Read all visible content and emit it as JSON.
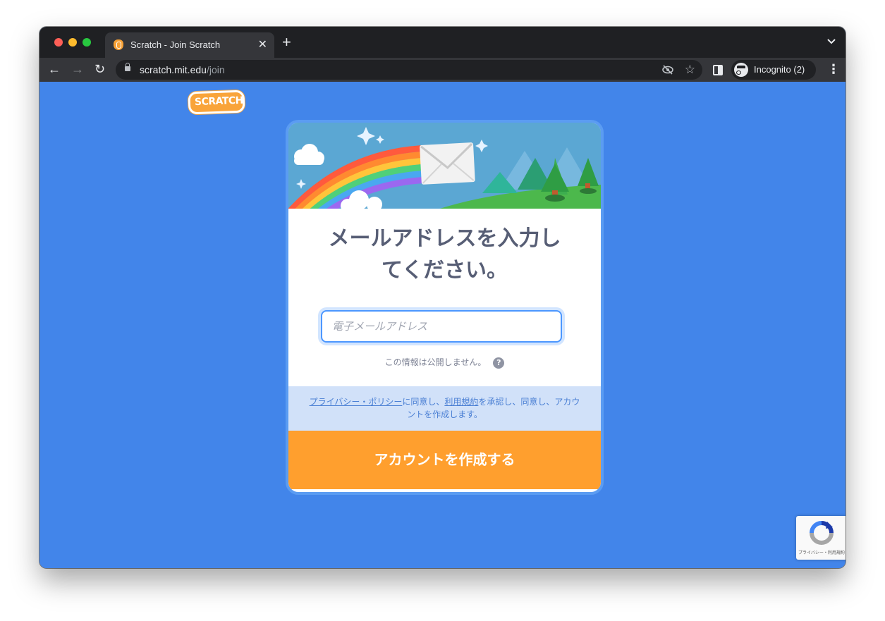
{
  "browser": {
    "tab_title": "Scratch - Join Scratch",
    "tab_close": "✕",
    "new_tab": "+",
    "tab_list": "⌄",
    "back": "←",
    "forward": "→",
    "reload": "↻",
    "url_host": "scratch.mit.edu",
    "url_path": "/join",
    "incognito_label": "Incognito (2)",
    "menu": "⋮",
    "star": "☆",
    "eye": "◉"
  },
  "page": {
    "logo_text": "SCRATCH",
    "heading_line1": "メールアドレスを入力し",
    "heading_line2": "てください。",
    "email_placeholder": "電子メールアドレス",
    "privacy_notice": "この情報は公開しません。",
    "help": "?",
    "consent": {
      "privacy_link": "プライバシー・ポリシー",
      "text1": "に同意し、",
      "terms_link": "利用規約",
      "text2": "を承認し、同意し、アカウントを作成します。"
    },
    "create_button": "アカウントを作成する",
    "recaptcha_text": "プライバシー・利用規約"
  },
  "colors": {
    "page_background": "#4285ea",
    "button": "#ff9f2e",
    "consent_background": "#d1e1f9",
    "heading": "#575e75"
  }
}
